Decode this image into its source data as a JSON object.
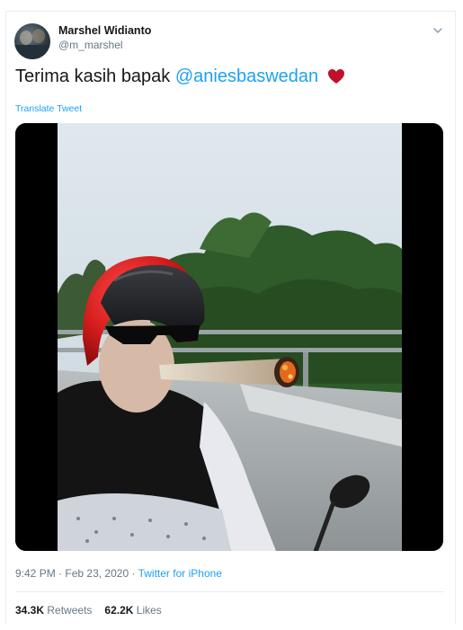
{
  "user": {
    "name": "Marshel Widianto",
    "handle": "@m_marshel"
  },
  "tweet": {
    "text_prefix": "Terima kasih bapak",
    "mention": "@aniesbaswedan",
    "heart_color": "#c0102a",
    "translate_label": "Translate Tweet"
  },
  "meta": {
    "time": "9:42 PM",
    "separator": "·",
    "date": "Feb 23, 2020",
    "source": "Twitter for iPhone"
  },
  "stats": {
    "retweets_count": "34.3K",
    "retweets_label": "Retweets",
    "likes_count": "62.2K",
    "likes_label": "Likes"
  },
  "icons": {
    "chevron": "chevron-down-icon",
    "heart": "heart-icon"
  },
  "colors": {
    "accent": "#1da1f2",
    "secondary_text": "#657786",
    "divider": "#e6ecf0"
  }
}
